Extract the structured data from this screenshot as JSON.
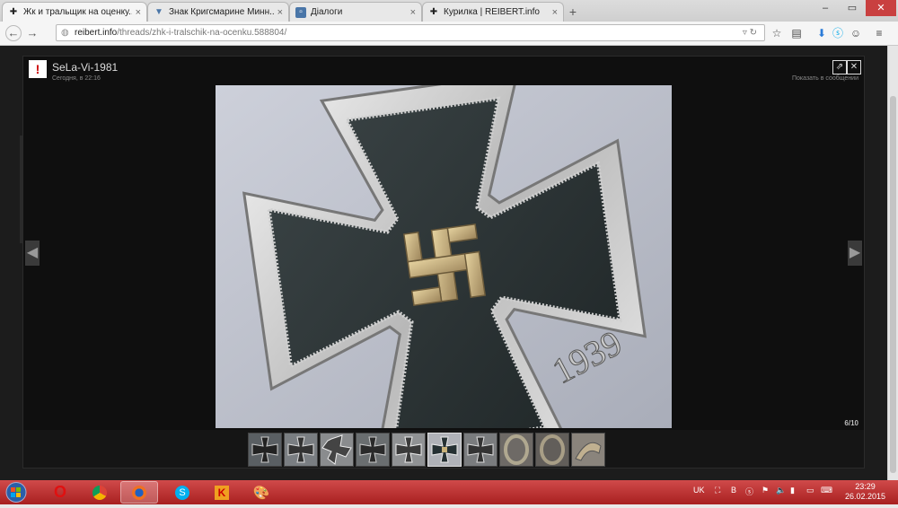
{
  "browser": {
    "tabs": [
      {
        "label": "Жк и тральщик на оценку...",
        "icon": "reibert-favicon-icon",
        "active": true
      },
      {
        "label": "Знак Кригсмарине Минн...",
        "icon": "vk-favicon-icon",
        "active": false
      },
      {
        "label": "Діалоги",
        "icon": "dialogs-favicon-icon",
        "active": false
      },
      {
        "label": "Курилка | REIBERT.info",
        "icon": "reibert-favicon-icon",
        "active": false
      }
    ],
    "new_tab": "+",
    "window_controls": {
      "minimize": "–",
      "maximize": "▭",
      "close": "✕"
    },
    "url_host": "reibert.info",
    "url_path": "/threads/zhk-i-tralschik-na-ocenku.588804/"
  },
  "lightbox": {
    "username": "SeLa-Vi-1981",
    "date": "Сегодня, в 22:16",
    "show_in_post": "Показать в сообщении",
    "counter": "6/10",
    "photo_text": "1939",
    "thumbnail_count": 10,
    "selected_index": 5
  },
  "taskbar": {
    "language": "UK",
    "time": "23:29",
    "date": "26.02.2015"
  },
  "colors": {
    "taskbar": "#b82828",
    "overlay": "#1c1c1c",
    "accent": "#2a7bd8"
  }
}
